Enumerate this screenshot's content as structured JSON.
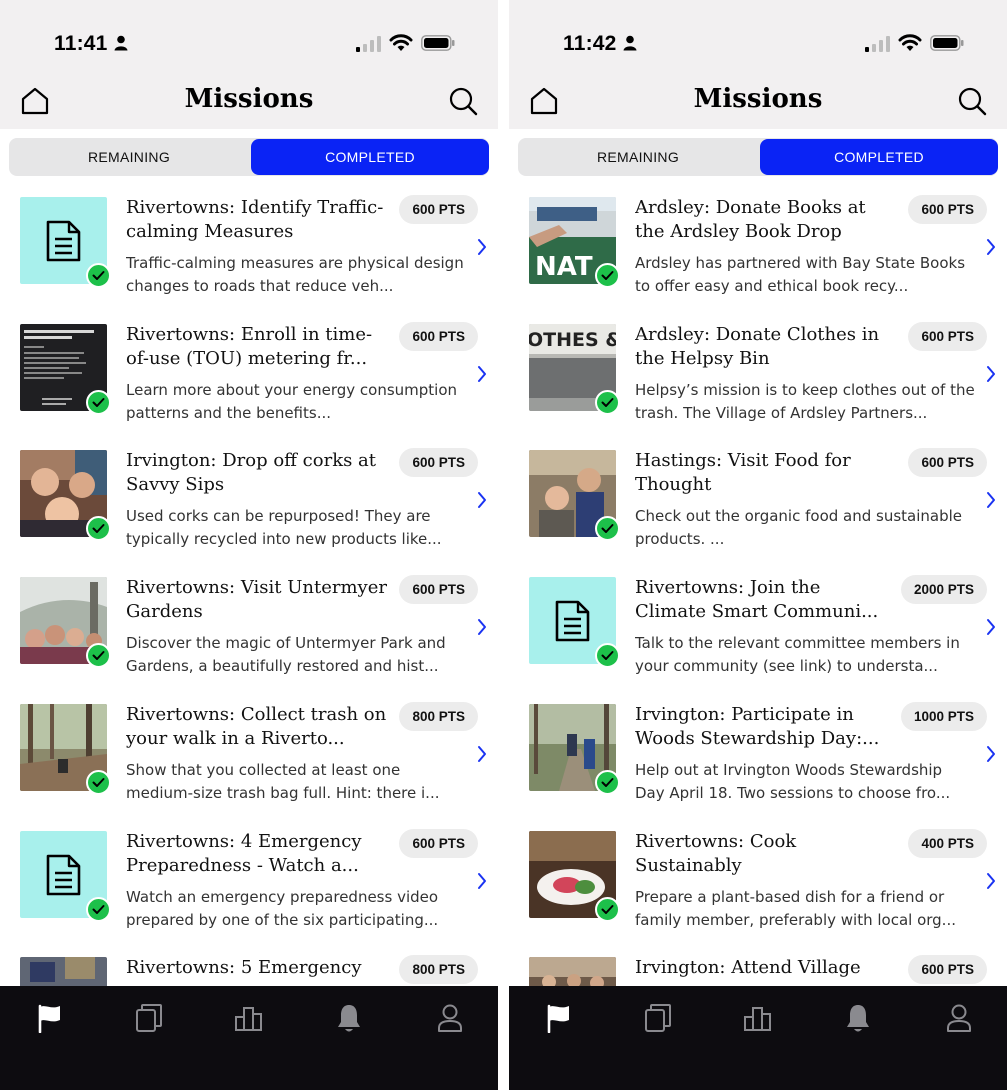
{
  "screens": [
    {
      "status": {
        "time": "11:41"
      },
      "header": {
        "title": "Missions"
      },
      "tabs": {
        "remaining": "REMAINING",
        "completed": "COMPLETED"
      },
      "missions": [
        {
          "title": "Rivertowns: Identify Traffic-calming Measures",
          "points": "600 PTS",
          "desc": "Traffic-calming measures are physical design changes to roads that reduce veh...",
          "thumb": "doc-icon"
        },
        {
          "title": "Rivertowns: Enroll in time-of-use (TOU) metering fr...",
          "points": "600 PTS",
          "desc": "Learn more about your energy consumption patterns and the benefits...",
          "thumb": "dark-screenshot"
        },
        {
          "title": "Irvington: Drop off corks at Savvy Sips",
          "points": "600 PTS",
          "desc": "Used corks can be repurposed! They are typically recycled into new products like...",
          "thumb": "photo-selfie"
        },
        {
          "title": "Rivertowns: Visit Untermyer Gardens",
          "points": "600 PTS",
          "desc": "Discover the magic of Untermyer Park and Gardens, a beautifully restored and hist...",
          "thumb": "photo-garden"
        },
        {
          "title": "Rivertowns: Collect trash on your walk in a Riverto...",
          "points": "800 PTS",
          "desc": "Show that you collected at least one medium-size trash bag full. Hint: there i...",
          "thumb": "photo-woods"
        },
        {
          "title": "Rivertowns: 4 Emergency Preparedness - Watch a...",
          "points": "600 PTS",
          "desc": "Watch an emergency preparedness video prepared by one of the six participating...",
          "thumb": "doc-icon"
        },
        {
          "title": "Rivertowns: 5 Emergency",
          "points": "800 PTS",
          "desc": "",
          "thumb": "photo-partial"
        }
      ]
    },
    {
      "status": {
        "time": "11:42"
      },
      "header": {
        "title": "Missions"
      },
      "tabs": {
        "remaining": "REMAINING",
        "completed": "COMPLETED"
      },
      "missions": [
        {
          "title": "Ardsley: Donate Books at the Ardsley Book Drop",
          "points": "600 PTS",
          "desc": "Ardsley has partnered with Bay State Books to offer easy and ethical book recy...",
          "thumb": "photo-books"
        },
        {
          "title": "Ardsley:  Donate Clothes in the Helpsy Bin",
          "points": "600 PTS",
          "desc": "Helpsy’s mission is to keep clothes out of the trash. The Village of Ardsley Partners...",
          "thumb": "photo-clothes"
        },
        {
          "title": "Hastings: Visit Food for Thought",
          "points": "600 PTS",
          "desc": "Check out the organic food and sustainable products. ...",
          "thumb": "photo-store"
        },
        {
          "title": "Rivertowns: Join the Climate Smart Communi...",
          "points": "2000 PTS",
          "desc": "Talk to the relevant committee members in your community (see link) to understa...",
          "thumb": "doc-icon"
        },
        {
          "title": "Irvington: Participate in Woods Stewardship Day:...",
          "points": "1000 PTS",
          "desc": "Help out at Irvington Woods Stewardship Day April 18. Two sessions to choose fro...",
          "thumb": "photo-trail"
        },
        {
          "title": "Rivertowns: Cook Sustainably",
          "points": "400 PTS",
          "desc": "Prepare a plant-based dish for a friend or family member, preferably with local org...",
          "thumb": "photo-dish"
        },
        {
          "title": "Irvington: Attend Village",
          "points": "600 PTS",
          "desc": "",
          "thumb": "photo-meeting"
        }
      ]
    }
  ],
  "bottom_nav": [
    "flag-icon",
    "cards-icon",
    "leaderboard-icon",
    "bell-icon",
    "profile-icon"
  ],
  "colors": {
    "accent": "#0a23f5",
    "check": "#1dc04a",
    "doc_tile": "#a8f0ec",
    "nav_bg": "#0d0c10",
    "header_bg": "#f2f0f1"
  }
}
